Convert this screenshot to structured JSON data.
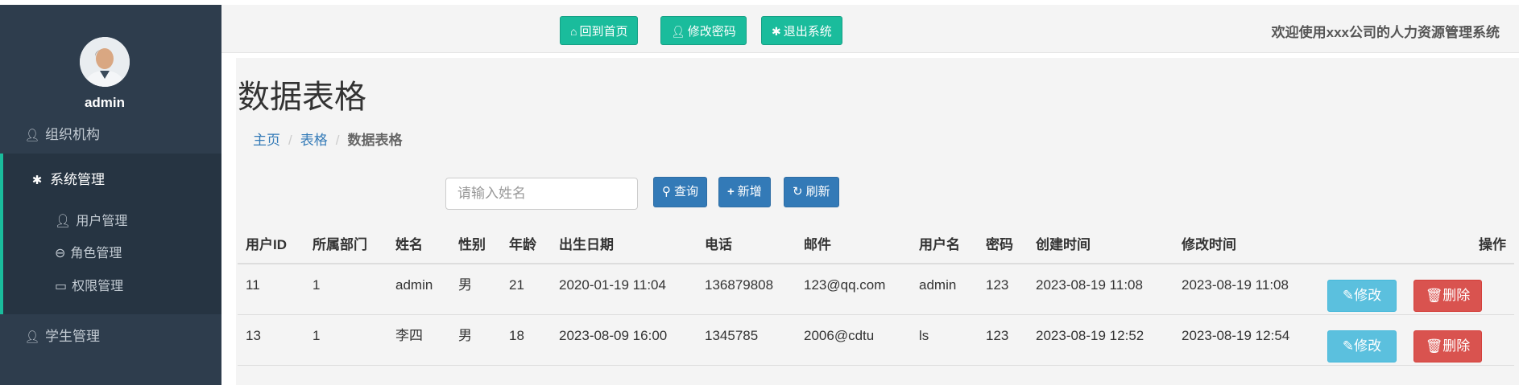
{
  "sidebar": {
    "username": "admin",
    "org_label": "组织机构",
    "sys_label": "系统管理",
    "sub_items": [
      "用户管理",
      "角色管理",
      "权限管理"
    ],
    "student_label": "学生管理"
  },
  "topbar": {
    "home_label": "回到首页",
    "password_label": "修改密码",
    "logout_label": "退出系统",
    "welcome": "欢迎使用xxx公司的人力资源管理系统"
  },
  "page": {
    "title": "数据表格",
    "breadcrumb": [
      "主页",
      "表格",
      "数据表格"
    ]
  },
  "search": {
    "placeholder": "请输入姓名",
    "query_label": "查询",
    "add_label": "新增",
    "refresh_label": "刷新"
  },
  "table": {
    "headers": [
      "用户ID",
      "所属部门",
      "姓名",
      "性别",
      "年龄",
      "出生日期",
      "电话",
      "邮件",
      "用户名",
      "密码",
      "创建时间",
      "修改时间",
      "操作"
    ],
    "rows": [
      [
        "11",
        "1",
        "admin",
        "男",
        "21",
        "2020-01-19 11:04",
        "136879808",
        "123@qq.com",
        "admin",
        "123",
        "2023-08-19 11:08",
        "2023-08-19 11:08"
      ],
      [
        "13",
        "1",
        "李四",
        "男",
        "18",
        "2023-08-09 16:00",
        "1345785",
        "2006@cdtu",
        "ls",
        "123",
        "2023-08-19 12:52",
        "2023-08-19 12:54"
      ]
    ],
    "edit_label": "修改",
    "delete_label": "删除"
  },
  "colors": {
    "sidebar_bg": "#2e3d4d",
    "accent_green": "#1abc9c",
    "primary_blue": "#337ab7",
    "info": "#5bc0de",
    "danger": "#d9534f"
  }
}
